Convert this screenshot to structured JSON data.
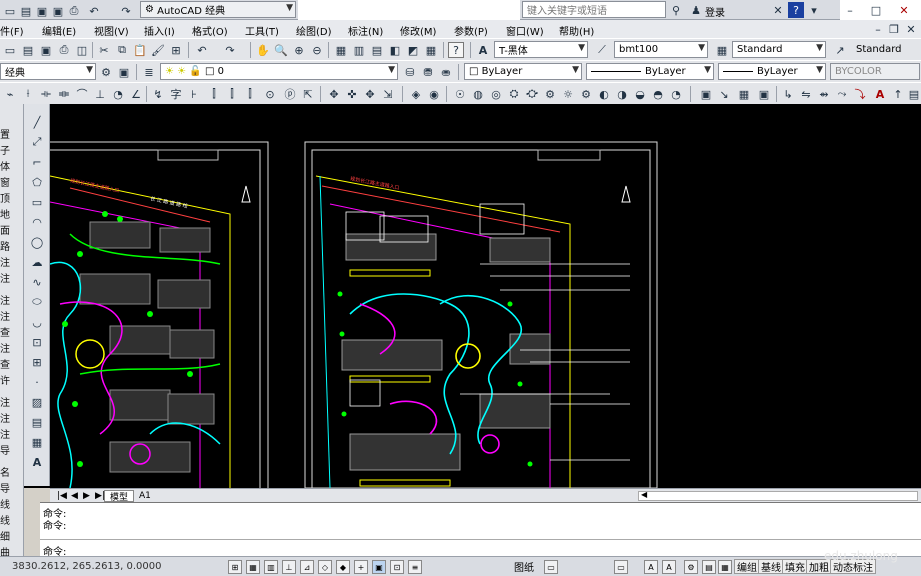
{
  "title": {
    "workspace_combo": "AutoCAD 经典",
    "search_placeholder": "键入关键字或短语",
    "login_label": "登录"
  },
  "menus": [
    "件(F)",
    "编辑(E)",
    "视图(V)",
    "插入(I)",
    "格式(O)",
    "工具(T)",
    "绘图(D)",
    "标注(N)",
    "修改(M)",
    "参数(P)",
    "窗口(W)",
    "帮助(H)"
  ],
  "styles": {
    "text_style": "T-黑体",
    "dim_style": "bmt100",
    "table_style": "Standard",
    "multileader_style": "Standard"
  },
  "layers": {
    "workspace": "经典",
    "current_layer": "0",
    "color": "ByLayer",
    "linetype": "ByLayer",
    "lineweight": "ByLayer",
    "plotstyle": "BYCOLOR"
  },
  "left_palette_chars": [
    "置",
    "子",
    "体",
    "窗",
    "顶",
    "地",
    "面",
    "路",
    "注",
    "注",
    "注",
    "注",
    "查",
    "注",
    "查",
    "许",
    "注",
    "注",
    "注",
    "导",
    "名",
    "导",
    "线",
    "线",
    "细",
    "曲"
  ],
  "drawing": {
    "road_label_left": "规划长江路主道路入口",
    "road_label_right": "规划长江路主道路入口",
    "street_label": "长 江 路 道 路 线"
  },
  "tabs": [
    "模型",
    "A1"
  ],
  "command": {
    "history": [
      "命令:",
      "命令:"
    ],
    "prompt": "命令:"
  },
  "status": {
    "coords": "3830.2612, 265.2613, 0.0000",
    "paper_label": "图纸",
    "buttons": [
      "编组",
      "基线",
      "填充",
      "加粗",
      "动态标注"
    ],
    "watermark": "edu.zhulong"
  },
  "colors": {
    "background": "#000000",
    "cyan": "#00ffff",
    "magenta": "#ff00ff",
    "green": "#00ff00",
    "yellow": "#ffff00"
  }
}
